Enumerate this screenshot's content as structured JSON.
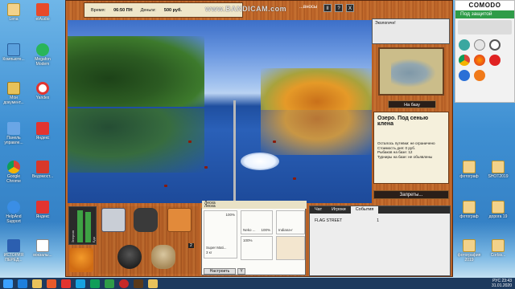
{
  "desktop": {
    "icons_left": [
      {
        "label": "Lena"
      },
      {
        "label": "etAudio"
      },
      {
        "label": "Компьюте..."
      },
      {
        "label": "Megafon Modem"
      },
      {
        "label": "Мои документ..."
      },
      {
        "label": "Yandex"
      },
      {
        "label": "Панель управле..."
      },
      {
        "label": "Яндекс"
      },
      {
        "label": "Google Chrome"
      },
      {
        "label": "Ведомост..."
      },
      {
        "label": "HelpAnd Support"
      },
      {
        "label": "Яндекс"
      },
      {
        "label": "ИСТОРИЯ ПЕРЕД..."
      },
      {
        "label": "вокзалы..."
      }
    ],
    "icons_right": [
      {
        "label": "фотограф"
      },
      {
        "label": "SHOT2019"
      },
      {
        "label": "фотограф"
      },
      {
        "label": "дорога 19"
      },
      {
        "label": "фотография 2019"
      },
      {
        "label": "Corbis..."
      }
    ]
  },
  "watermark": "www.BANDICAM.com",
  "game": {
    "top": {
      "time_label": "Время:",
      "time_value": "06:50 ПН",
      "money_label": "Деньги:",
      "money_value": "500 руб.",
      "btn_pause": "II",
      "btn_help": "?",
      "btn_close": "X",
      "news_label": "...вносы"
    },
    "sidebar": {
      "message": "Экологичн!",
      "to_base": "На базу",
      "lake_title": "Озеро. Под сенью клена",
      "lake_lines": [
        "Осталось путевки: не ограничено",
        "Стоимость дня: 0 руб.",
        "Рыбаков на базе: 12",
        "",
        "Турниры на базе: не объявлены"
      ],
      "bans": "Запреты..."
    },
    "bottom": {
      "gauge_labels": [
        "Энергия",
        "Еда"
      ],
      "line_label_1": "Леска",
      "line_label_2": "Леска",
      "gear": {
        "rod_name": "Super Mati...",
        "rod_weight": "3 кг",
        "rod_pct": "100%",
        "reel_label": "Neko ...",
        "reel_pct": "100%",
        "line_label": "Indiana-r",
        "hook_pct": "100%",
        "setup_btn": "Настроить",
        "y_btn": "Y"
      },
      "chat": {
        "tabs": [
          "Чат",
          "Игроки",
          "События"
        ],
        "active_tab": 2,
        "row_name": "FLAG STREET",
        "row_value": "1"
      },
      "inv_count": "2"
    }
  },
  "comodo": {
    "brand": "COMODO",
    "status": "Под защитой",
    "row1": "ЗАЩИТИТЬ",
    "row2": "ЗАЩИТИТЬ"
  },
  "taskbar": {
    "time": "23:43",
    "date": "31.01.2020",
    "lang": "РУС"
  }
}
